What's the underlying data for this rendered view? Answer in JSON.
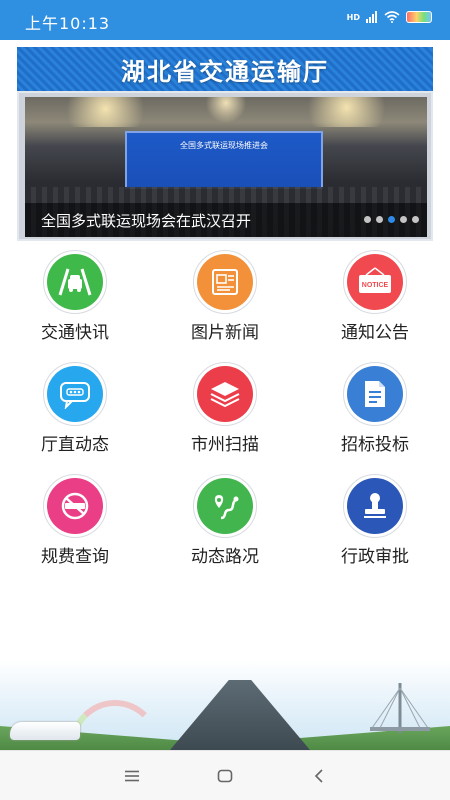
{
  "status_bar": {
    "time": "上午10:13",
    "network_label": "HD",
    "colors": {
      "background": "#2f8fe0"
    }
  },
  "header": {
    "title": "湖北省交通运输厅"
  },
  "carousel": {
    "screen_text": "全国多式联运现场推进会",
    "caption": "全国多式联运现场会在武汉召开",
    "total_slides": 5,
    "active_index": 2
  },
  "menu": [
    {
      "label": "交通快讯",
      "icon": "car-road-icon",
      "color": "#3fb94a"
    },
    {
      "label": "图片新闻",
      "icon": "picture-news-icon",
      "color": "#f2913a"
    },
    {
      "label": "通知公告",
      "icon": "notice-icon",
      "color": "#f0494f",
      "icon_text": "NOTICE"
    },
    {
      "label": "厅直动态",
      "icon": "chat-bubble-icon",
      "color": "#27a7ee"
    },
    {
      "label": "市州扫描",
      "icon": "layers-icon",
      "color": "#ec3e4a"
    },
    {
      "label": "招标投标",
      "icon": "document-icon",
      "color": "#3a7fd6"
    },
    {
      "label": "规费查询",
      "icon": "no-entry-icon",
      "color": "#ea3f86"
    },
    {
      "label": "动态路况",
      "icon": "map-route-icon",
      "color": "#43b54e"
    },
    {
      "label": "行政审批",
      "icon": "stamp-icon",
      "color": "#2b57b8"
    }
  ],
  "nav": {
    "menu_icon": "menu-icon",
    "home_icon": "home-icon",
    "back_icon": "back-icon"
  }
}
